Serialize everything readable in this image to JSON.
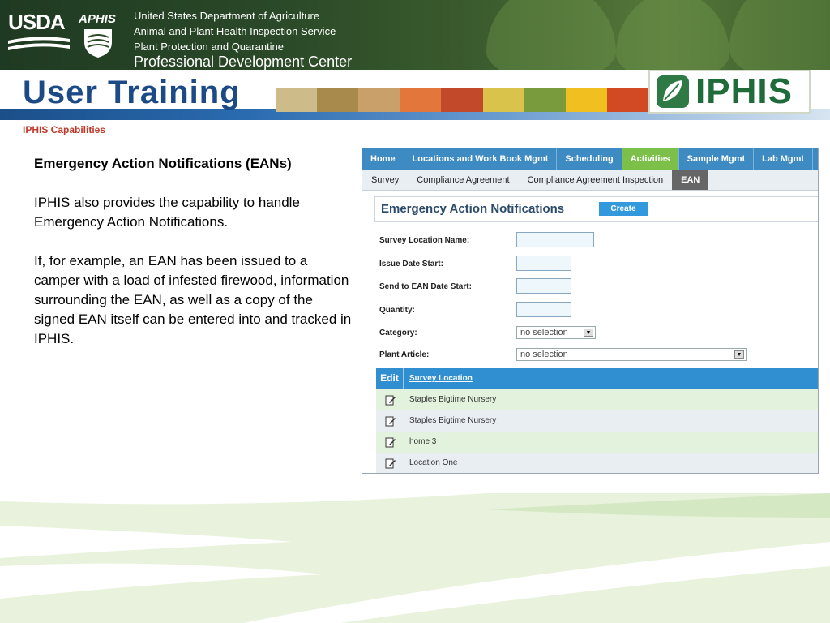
{
  "header": {
    "usda_logo": "USDA",
    "aphis_logo": "APHIS",
    "lines": [
      "United States Department of Agriculture",
      "Animal and Plant Health Inspection Service",
      "Plant Protection and Quarantine"
    ],
    "center": "Professional Development Center"
  },
  "banner": {
    "title": "User Training",
    "iphis_logo": "IPHIS"
  },
  "section_label": "IPHIS Capabilities",
  "content": {
    "heading": "Emergency Action Notifications (EANs)",
    "paragraph1": "IPHIS also provides the capability to handle Emergency Action Notifications.",
    "paragraph2": "If, for example, an EAN has been issued to a camper with a load of infested firewood, information surrounding the EAN, as well as a copy of the signed EAN itself can be entered into and tracked in IPHIS."
  },
  "app": {
    "nav_primary": [
      "Home",
      "Locations and Work Book Mgmt",
      "Scheduling",
      "Activities",
      "Sample Mgmt",
      "Lab Mgmt"
    ],
    "nav_primary_active": "Activities",
    "nav_secondary": [
      "Survey",
      "Compliance Agreement",
      "Compliance Agreement Inspection",
      "EAN"
    ],
    "nav_secondary_active": "EAN",
    "page_title": "Emergency Action Notifications",
    "create_label": "Create",
    "form": {
      "survey_location_name_label": "Survey Location Name:",
      "issue_date_start_label": "Issue Date Start:",
      "send_to_ean_date_start_label": "Send to EAN Date Start:",
      "quantity_label": "Quantity:",
      "category_label": "Category:",
      "category_value": "no selection",
      "plant_article_label": "Plant Article:",
      "plant_article_value": "no selection"
    },
    "grid": {
      "edit_header": "Edit",
      "location_header": "Survey Location",
      "rows": [
        "Staples Bigtime Nursery",
        "Staples Bigtime Nursery",
        "home 3",
        "Location One"
      ]
    }
  },
  "colors": {
    "nav_blue": "#3e8bc4",
    "nav_active_green": "#7cc04a",
    "banner_blue": "#1c4a86",
    "iphis_green": "#1f6b3a",
    "section_red": "#c0392b"
  }
}
